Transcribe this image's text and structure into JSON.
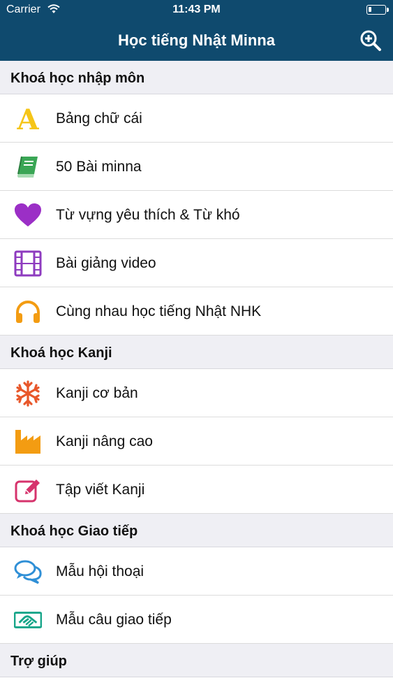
{
  "status_bar": {
    "carrier": "Carrier",
    "time": "11:43 PM"
  },
  "nav": {
    "title": "Học tiếng Nhật Minna",
    "zoom_icon": "zoom-in-icon",
    "background": "#0f4a6e"
  },
  "sections": [
    {
      "title": "Khoá học nhập môn",
      "items": [
        {
          "label": "Bảng chữ cái",
          "icon": "letter-a-icon",
          "color": "#f5c518"
        },
        {
          "label": "50 Bài minna",
          "icon": "book-icon",
          "color": "#3aa655"
        },
        {
          "label": "Từ vựng yêu thích & Từ khó",
          "icon": "heart-icon",
          "color": "#9b2fc6"
        },
        {
          "label": "Bài giảng video",
          "icon": "film-icon",
          "color": "#8e3bbf"
        },
        {
          "label": "Cùng nhau học tiếng Nhật NHK",
          "icon": "headphones-icon",
          "color": "#f39c12"
        }
      ]
    },
    {
      "title": "Khoá học Kanji",
      "items": [
        {
          "label": "Kanji cơ bản",
          "icon": "snowflake-icon",
          "color": "#e8572a"
        },
        {
          "label": "Kanji nâng cao",
          "icon": "factory-icon",
          "color": "#f39c12"
        },
        {
          "label": "Tập viết Kanji",
          "icon": "edit-icon",
          "color": "#d6336c"
        }
      ]
    },
    {
      "title": "Khoá học Giao tiếp",
      "items": [
        {
          "label": "Mẫu hội thoại",
          "icon": "chat-icon",
          "color": "#2f8fd6"
        },
        {
          "label": "Mẫu câu giao tiếp",
          "icon": "handshake-icon",
          "color": "#17a589"
        }
      ]
    },
    {
      "title": "Trợ giúp",
      "items": []
    }
  ]
}
